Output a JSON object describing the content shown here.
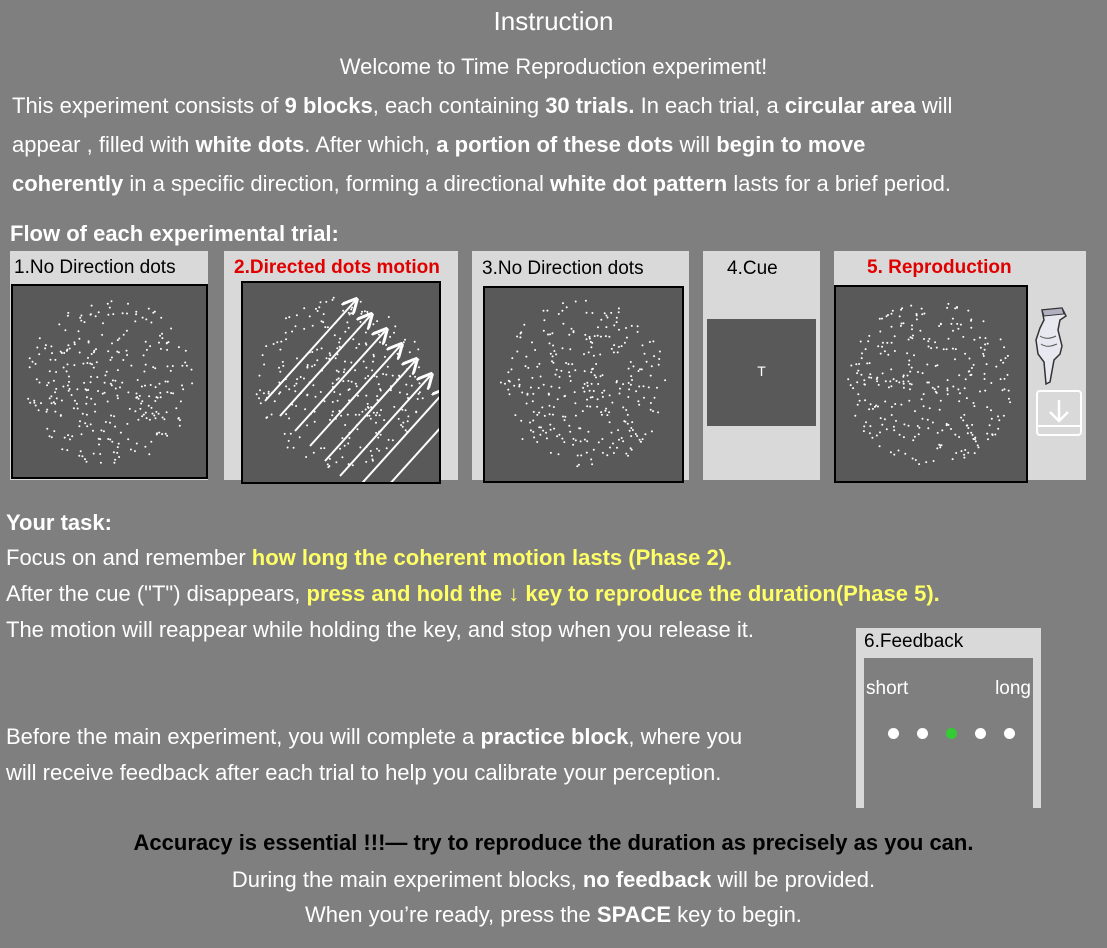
{
  "title": "Instruction",
  "welcome": "Welcome to Time Reproduction experiment!",
  "intro": {
    "line1": [
      "This experiment consists of ",
      "9 blocks",
      ", each containing ",
      "30 trials.",
      " In each trial, a ",
      "circular area",
      " will"
    ],
    "line2": [
      "appear , filled with  ",
      "white dots",
      ". After which, ",
      "a portion of these dots",
      " will ",
      "begin to move"
    ],
    "line3": [
      "coherently",
      " in a specific direction, forming a directional ",
      "white dot pattern",
      "  lasts for a brief period."
    ]
  },
  "flow_heading": "Flow of each experimental trial:",
  "phases": [
    {
      "label": "1.No Direction dots"
    },
    {
      "label": "2.Directed dots motion"
    },
    {
      "label": "3.No Direction dots"
    },
    {
      "label": "4.Cue",
      "cue_letter": "T"
    },
    {
      "label": "5. Reproduction"
    }
  ],
  "icons": {
    "hand": "pressing-hand-icon",
    "key": "down-arrow-key-icon"
  },
  "task": {
    "heading": "Your task:",
    "l1a": "Focus on and remember ",
    "l1b": "how long the coherent motion lasts (Phase 2).",
    "l2a": "After the cue (\"T\") disappears, ",
    "l2b": "press and hold the ↓ key to reproduce the duration(Phase 5).",
    "l3": "The motion will reappear while holding the key, and stop when you release it.",
    "l4a": "Before the main experiment, you will complete a ",
    "l4b": "practice block",
    "l4c": ", where you",
    "l5": " will receive feedback after each trial to help you calibrate your perception."
  },
  "feedback": {
    "label": "6.Feedback",
    "short": "short",
    "long": "long",
    "dots": 5,
    "highlighted_dot": 3
  },
  "footer": {
    "accuracy": "Accuracy is essential !!!— try to reproduce the duration as precisely as you can.",
    "nofb_a": "During the main experiment blocks, ",
    "nofb_b": "no feedback",
    "nofb_c": " will be provided.",
    "ready_a": "When you’re ready, press the ",
    "ready_b": "SPACE",
    "ready_c": " key to begin."
  },
  "colors": {
    "background": "#7f7f7f",
    "highlight": "#ffff66",
    "red_label": "#e00000",
    "green_dot": "#33cc33",
    "panel": "#d9d9d9",
    "dot_field": "#595959"
  }
}
